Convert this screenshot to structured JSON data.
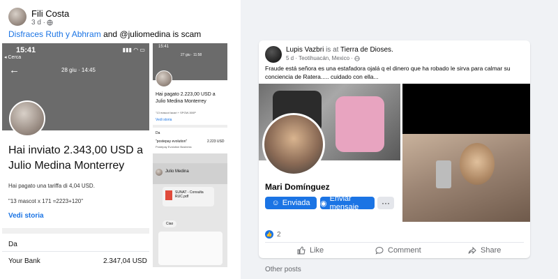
{
  "left_post": {
    "author": "Fili Costa",
    "time": "3 d ·",
    "caption_link": "Disfraces Ruth y Abhram",
    "caption_rest": "and @juliomedina is scam",
    "shot1": {
      "status_time": "15:41",
      "back_label": "◂ Cerca",
      "date": "28 giu · 14:45",
      "headline": "Hai inviato 2.343,00 USD a Julio Medina Monterrey",
      "fee": "Hai pagato una tariffa di 4,04 USD.",
      "note": "\"13 mascot x 171 =2223+120\"",
      "view_story": "Vedi storia",
      "from_label": "Da",
      "bank_name": "Your Bank",
      "bank_amount": "2.347,04 USD"
    },
    "shot2": {
      "status_time": "15:41",
      "date": "27 giu · 11:58",
      "headline": "Hai pagato 2.223,00 USD a Julio Medina Monterrey",
      "note": "\"13 mascot lacari + SPGW-500P",
      "view_story": "Vedi storia",
      "from_label": "Da",
      "merchant": "\"postepay evolution\"",
      "merchant_amount": "2.223 USD",
      "merchant_sub": "Postepay Evolution Business"
    },
    "shot3": {
      "contact": "Julio Medina",
      "file_title": "SUNAT - Consulta RUC.pdf",
      "bubble": "Ciao"
    }
  },
  "right_post": {
    "author": "Lupis Vazbri",
    "is_at": "is at",
    "place": "Tierra de Dioses.",
    "time": "5 d · Teotihuacán, Mexico ·",
    "text": "Fraude está señora es una estafadora  ojalá q el dinero que ha robado le sirva para calmar su conciencia  de Ratera..... cuidado con ella...",
    "profile_name": "Mari Domínguez",
    "btn_sent": "Enviada",
    "btn_message": "Enviar mensaje",
    "btn_more": "···",
    "reactions_count": "2",
    "like": "Like",
    "comment": "Comment",
    "share": "Share",
    "other_posts": "Other posts"
  },
  "colors": {
    "accent": "#1b74e4",
    "muted": "#65676b",
    "phone_bar": "#6b6b6b"
  }
}
